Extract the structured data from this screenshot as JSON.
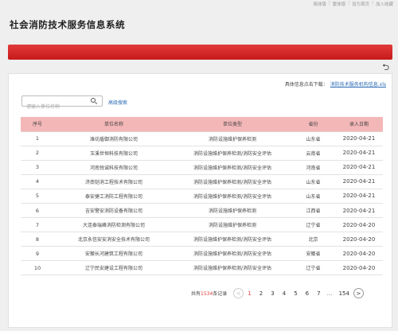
{
  "toplinks": [
    "简体版",
    "繁体版",
    "设为首页",
    "加入收藏"
  ],
  "title": "社会消防技术服务信息系统",
  "download": {
    "label": "具体信息点击下载：",
    "link": "消防技术服务机构信息.xls"
  },
  "search": {
    "placeholder": "请输入单位名称",
    "advanced": "高级搜索"
  },
  "table": {
    "headers": [
      "序号",
      "单位名称",
      "单位类型",
      "省份",
      "录入日期"
    ],
    "rows": [
      [
        "1",
        "潍坊盾御消防有限公司",
        "消防设施维护保养检测",
        "山东省",
        "2020-04-21"
      ],
      [
        "2",
        "玉溪世恒科技有限公司",
        "消防设施维护保养检测/消防安全评估",
        "云南省",
        "2020-04-21"
      ],
      [
        "3",
        "河南悦诚科技有限公司",
        "消防设施维护保养检测/消防安全评估",
        "河南省",
        "2020-04-21"
      ],
      [
        "4",
        "济南铠消工程技术有限公司",
        "消防设施维护保养检测/消防安全评估",
        "山东省",
        "2020-04-21"
      ],
      [
        "5",
        "泰安捷工消防工程有限公司",
        "消防设施维护保养检测/消防安全评估",
        "山东省",
        "2020-04-21"
      ],
      [
        "6",
        "吉安警安消防设备有限公司",
        "消防设施维护保养检测",
        "江西省",
        "2020-04-21"
      ],
      [
        "7",
        "大连泰瑞峰消防检测有限公司",
        "消防设施维护保养检测",
        "辽宁省",
        "2020-04-20"
      ],
      [
        "8",
        "北京永信安安消安全技术有限公司",
        "消防设施维护保养检测/消防安全评估",
        "北京",
        "2020-04-20"
      ],
      [
        "9",
        "安徽长河建筑工程有限公司",
        "消防设施维护保养检测/消防安全评估",
        "安徽省",
        "2020-04-20"
      ],
      [
        "10",
        "辽宁民安建设工程有限公司",
        "消防设施维护保养检测/消防安全评估",
        "辽宁省",
        "2020-04-20"
      ]
    ]
  },
  "pager": {
    "prefix": "共有",
    "total": "1534",
    "suffix": "条记录",
    "prev": "<",
    "pages": [
      "1",
      "2",
      "3",
      "4",
      "5",
      "6",
      "7"
    ],
    "active_index": 0,
    "ellipsis": "…",
    "last": "154",
    "next": ">"
  },
  "colors": {
    "accent_red": "#e23a3a",
    "header_pink": "#f4b7b7",
    "link_blue": "#2d6cb5"
  },
  "icons": {
    "back": "back-arrow-icon",
    "search": "search-icon"
  }
}
